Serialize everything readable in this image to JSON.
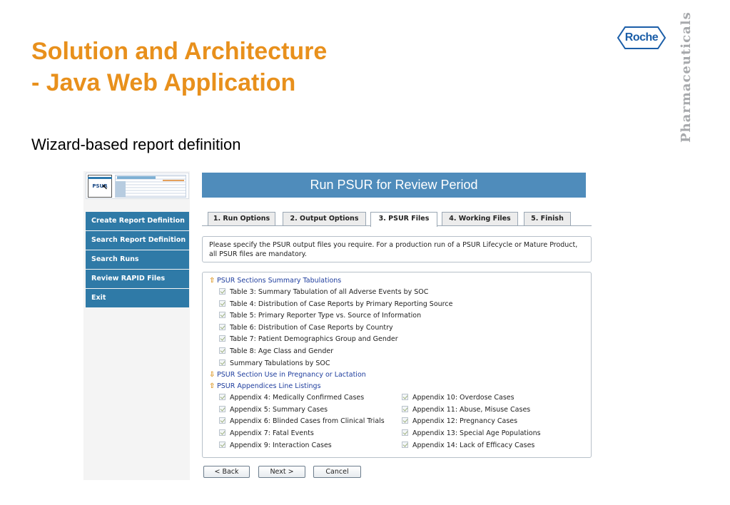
{
  "slide": {
    "title_line1": "Solution and Architecture",
    "title_line2": "- Java Web Application",
    "subtitle": "Wizard-based report definition",
    "brand_logo_text": "Roche",
    "brand_side_text": "Pharmaceuticals",
    "colors": {
      "title": "#e8901c",
      "brand_blue": "#1b5ea8",
      "side_text": "#a7a9ac"
    }
  },
  "app": {
    "logo_text": "PSUR",
    "header_title": "Run PSUR for Review Period",
    "nav": [
      {
        "label": "Create Report Definition"
      },
      {
        "label": "Search Report Definition"
      },
      {
        "label": "Search Runs"
      },
      {
        "label": "Review RAPID Files"
      },
      {
        "label": "Exit"
      }
    ],
    "tabs": [
      {
        "label": "1. Run Options",
        "active": false
      },
      {
        "label": "2. Output Options",
        "active": false
      },
      {
        "label": "3. PSUR Files",
        "active": true
      },
      {
        "label": "4. Working Files",
        "active": false
      },
      {
        "label": "5. Finish",
        "active": false
      }
    ],
    "intro_text": "Please specify the PSUR output files you require. For a production run of a PSUR Lifecycle or Mature Product, all PSUR files are mandatory.",
    "sections": {
      "summary": {
        "title": "PSUR Sections Summary Tabulations",
        "icon": "arrow-up-icon",
        "items": [
          "Table 3: Summary Tabulation of all Adverse Events by SOC",
          "Table 4: Distribution of Case Reports by Primary Reporting Source",
          "Table 5: Primary Reporter Type vs. Source of Information",
          "Table 6: Distribution of Case Reports by Country",
          "Table 7: Patient Demographics Group and Gender",
          "Table 8: Age Class and Gender",
          "Summary Tabulations by SOC"
        ]
      },
      "pregnancy": {
        "title": "PSUR Section Use in Pregnancy or Lactation",
        "icon": "arrow-down-icon"
      },
      "appendices": {
        "title": "PSUR Appendices Line Listings",
        "icon": "arrow-up-icon",
        "left": [
          "Appendix 4: Medically Confirmed Cases",
          "Appendix 5: Summary Cases",
          "Appendix 6: Blinded Cases from Clinical Trials",
          "Appendix 7: Fatal Events",
          "Appendix 9: Interaction Cases"
        ],
        "right": [
          "Appendix 10: Overdose Cases",
          "Appendix 11: Abuse, Misuse Cases",
          "Appendix 12: Pregnancy Cases",
          "Appendix 13: Special Age Populations",
          "Appendix 14: Lack of Efficacy Cases"
        ]
      }
    },
    "buttons": {
      "back": "< Back",
      "next": "Next >",
      "cancel": "Cancel"
    },
    "colors": {
      "header": "#4f8cbb",
      "nav": "#2f7aa7",
      "link": "#1f3e9e",
      "arrow": "#d99016"
    }
  }
}
